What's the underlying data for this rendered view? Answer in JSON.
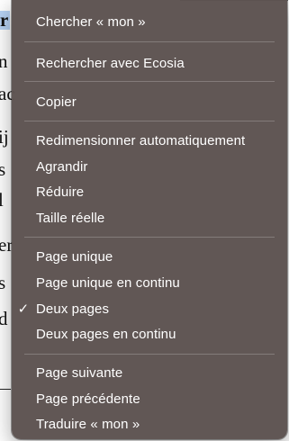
{
  "document": {
    "lines": [
      "r",
      "n",
      "ac",
      "ij",
      "s",
      "l",
      "er",
      "s",
      "d"
    ]
  },
  "menu": {
    "items": [
      {
        "label": "Chercher « mon »",
        "checked": false
      },
      {
        "label": "Rechercher avec Ecosia",
        "checked": false
      },
      {
        "label": "Copier",
        "checked": false
      },
      {
        "label": "Redimensionner automatiquement",
        "checked": false
      },
      {
        "label": "Agrandir",
        "checked": false
      },
      {
        "label": "Réduire",
        "checked": false
      },
      {
        "label": "Taille réelle",
        "checked": false
      },
      {
        "label": "Page unique",
        "checked": false
      },
      {
        "label": "Page unique en continu",
        "checked": false
      },
      {
        "label": "Deux pages",
        "checked": true
      },
      {
        "label": "Deux pages en continu",
        "checked": false
      },
      {
        "label": "Page suivante",
        "checked": false
      },
      {
        "label": "Page précédente",
        "checked": false
      },
      {
        "label": "Traduire « mon »",
        "checked": false
      }
    ],
    "check_mark": "✓"
  },
  "colors": {
    "menu_background": "#5c5250",
    "menu_text": "#ffffff",
    "selection_highlight": "#b7d3f5"
  }
}
